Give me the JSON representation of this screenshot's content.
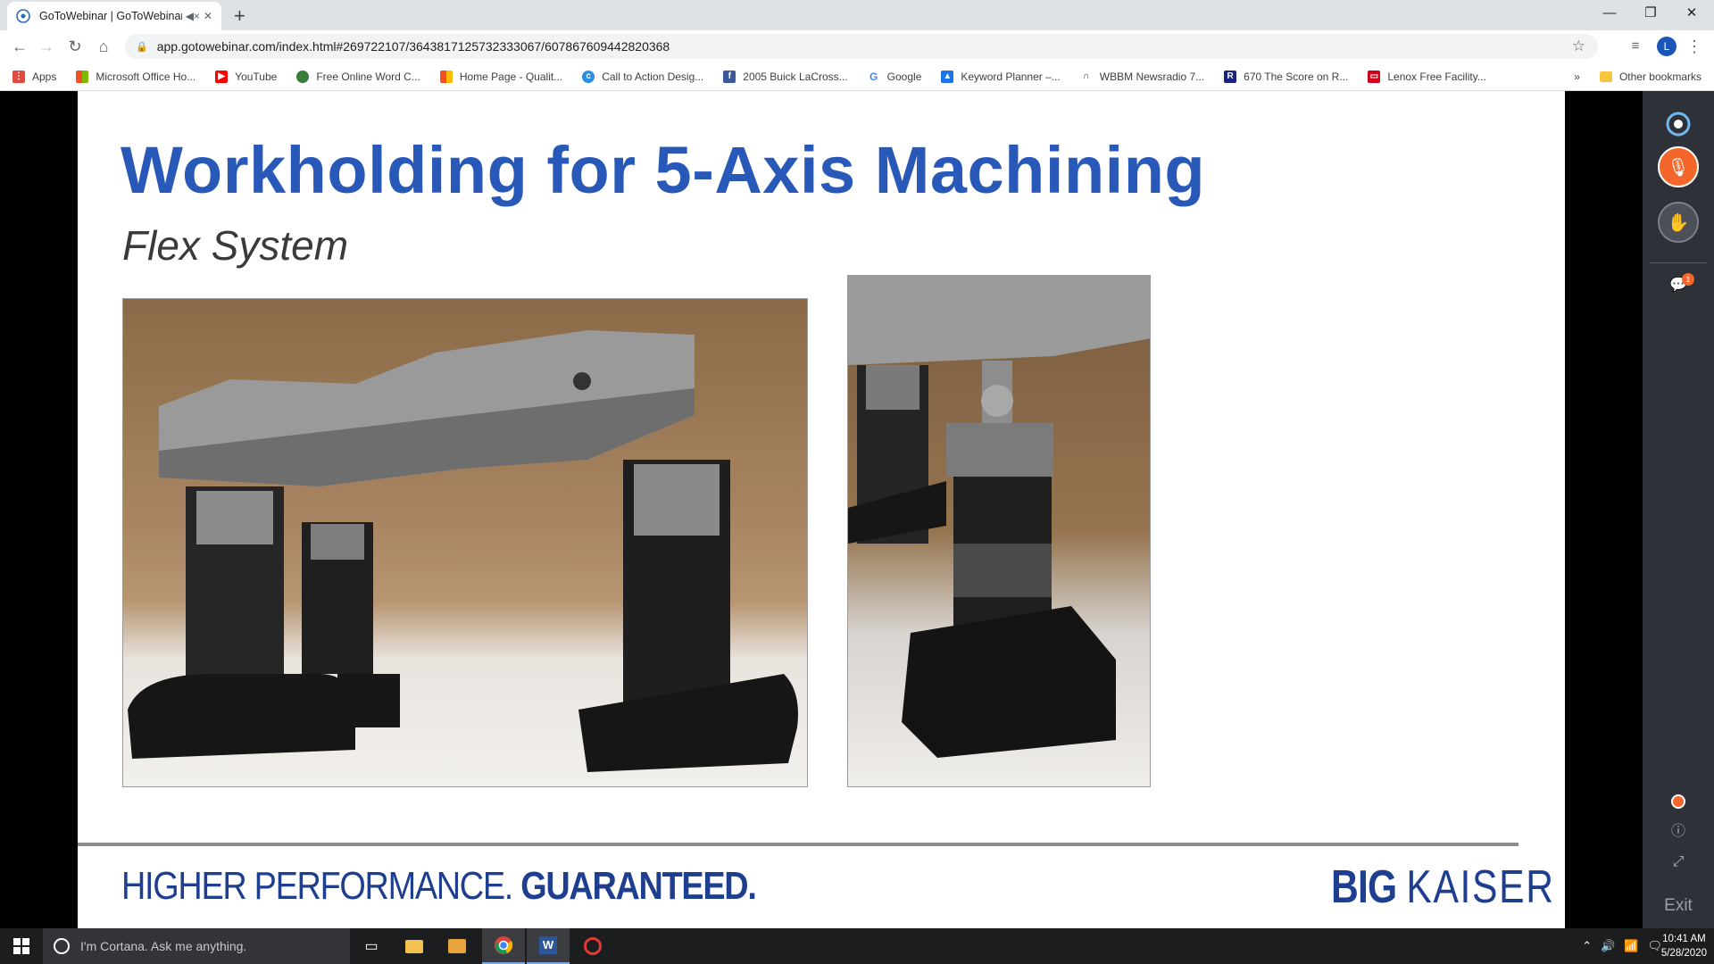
{
  "browser": {
    "tab_title": "GoToWebinar | GoToWebinar",
    "tab_audio_icon": "speaker-muted-icon",
    "url": "app.gotowebinar.com/index.html#269722107/3643817125732333067/607867609442820368",
    "profile_initial": "L"
  },
  "bookmarks": {
    "items": [
      {
        "label": "Apps",
        "icon": "apps-grid-icon",
        "color": "#e04a3f"
      },
      {
        "label": "Microsoft Office Ho...",
        "icon": "microsoft-icon",
        "color": "#f25022"
      },
      {
        "label": "YouTube",
        "icon": "youtube-icon",
        "color": "#ff0000"
      },
      {
        "label": "Free Online Word C...",
        "icon": "globe-icon",
        "color": "#3a7d3a"
      },
      {
        "label": "Home Page - Qualit...",
        "icon": "microsoft-icon",
        "color": "#f25022"
      },
      {
        "label": "Call to Action Desig...",
        "icon": "cta-icon",
        "color": "#2b8ce0"
      },
      {
        "label": "2005 Buick LaCross...",
        "icon": "facebook-icon",
        "color": "#3b5998"
      },
      {
        "label": "Google",
        "icon": "google-icon",
        "color": "#4285f4"
      },
      {
        "label": "Keyword Planner –...",
        "icon": "google-ads-icon",
        "color": "#1a73e8"
      },
      {
        "label": "WBBM Newsradio 7...",
        "icon": "headphones-icon",
        "color": "#333333"
      },
      {
        "label": "670 The Score on R...",
        "icon": "score-icon",
        "color": "#1a237e"
      },
      {
        "label": "Lenox Free Facility...",
        "icon": "lenox-icon",
        "color": "#d0021b"
      }
    ],
    "overflow": "»",
    "other": "Other bookmarks"
  },
  "slide": {
    "title": "Workholding for 5-Axis Machining",
    "subtitle": "Flex System",
    "tagline_part1": "HIGHER PERFORMANCE.",
    "tagline_part2": "GUARANTEED.",
    "brand_part1": "BIG",
    "brand_part2": "KAISER"
  },
  "webinar_panel": {
    "badge_count": "1",
    "exit_label": "Exit",
    "accent_color": "#f4662a"
  },
  "taskbar": {
    "search_placeholder": "I'm Cortana. Ask me anything.",
    "time": "10:41 AM",
    "date": "5/28/2020"
  }
}
